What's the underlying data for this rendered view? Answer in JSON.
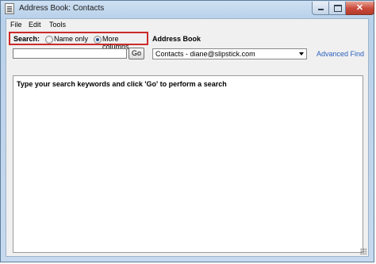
{
  "window": {
    "title": "Address Book: Contacts",
    "close_glyph": "✕"
  },
  "menu": [
    "File",
    "Edit",
    "Tools"
  ],
  "search": {
    "label": "Search:",
    "options": [
      {
        "label": "Name only",
        "selected": false
      },
      {
        "label": "More columns",
        "selected": true
      }
    ],
    "input_value": "",
    "go_label": "Go"
  },
  "address_book": {
    "label": "Address Book",
    "selected": "Contacts - diane@slipstick.com",
    "advanced_find_label": "Advanced Find"
  },
  "results": {
    "message": "Type your search keywords and click 'Go' to perform a search"
  },
  "colors": {
    "highlight_border": "#cc2a2a",
    "link": "#2a61c0",
    "titlebar": "#b9d1ea"
  }
}
